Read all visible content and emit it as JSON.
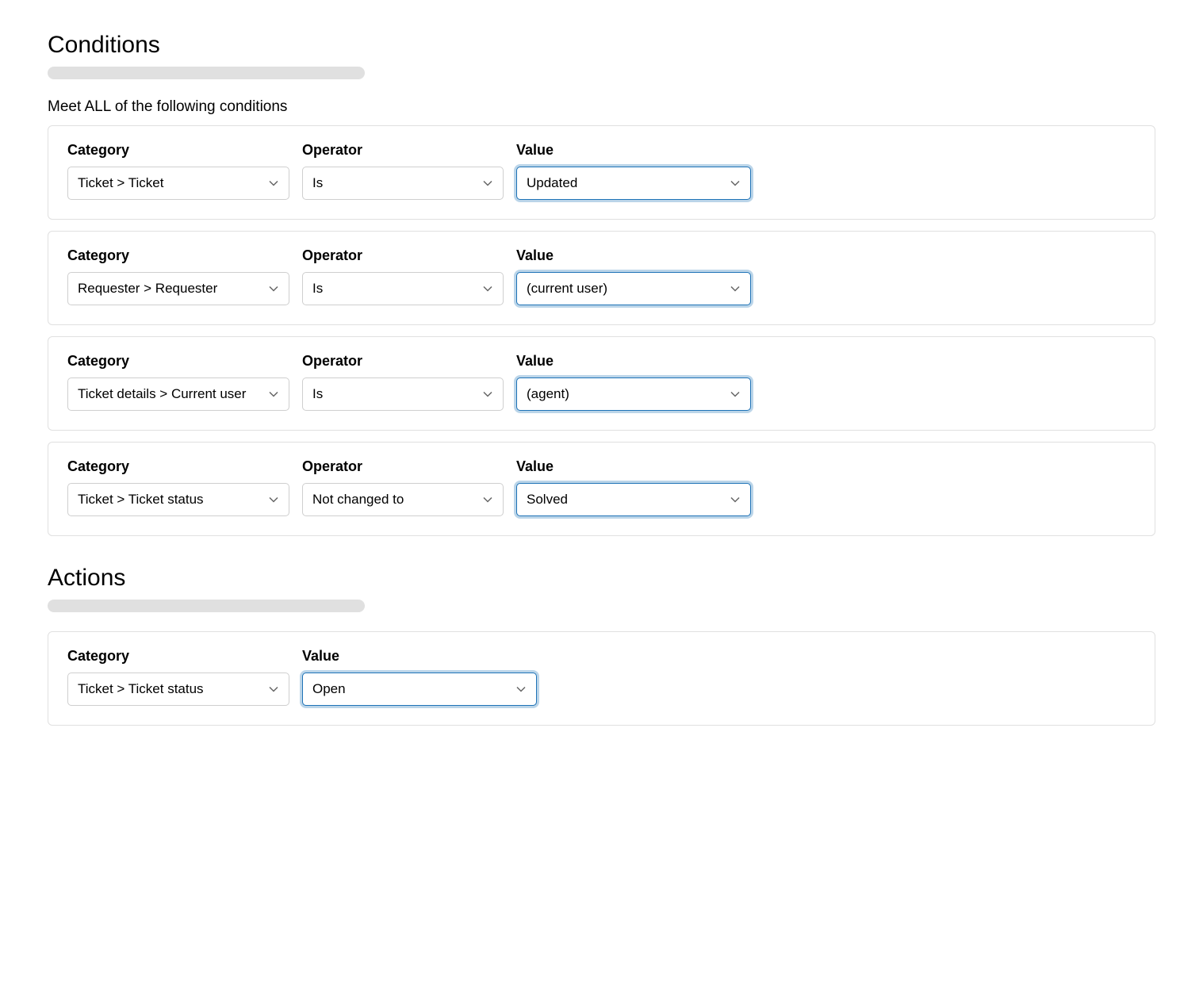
{
  "conditions": {
    "heading": "Conditions",
    "subtitle": "Meet ALL of the following conditions",
    "labels": {
      "category": "Category",
      "operator": "Operator",
      "value": "Value"
    },
    "rows": [
      {
        "category": "Ticket > Ticket",
        "operator": "Is",
        "value": "Updated"
      },
      {
        "category": "Requester > Requester",
        "operator": "Is",
        "value": "(current user)"
      },
      {
        "category": "Ticket details > Current user",
        "operator": "Is",
        "value": "(agent)"
      },
      {
        "category": "Ticket > Ticket status",
        "operator": "Not changed to",
        "value": "Solved"
      }
    ]
  },
  "actions": {
    "heading": "Actions",
    "labels": {
      "category": "Category",
      "value": "Value"
    },
    "rows": [
      {
        "category": "Ticket > Ticket status",
        "value": "Open"
      }
    ]
  }
}
